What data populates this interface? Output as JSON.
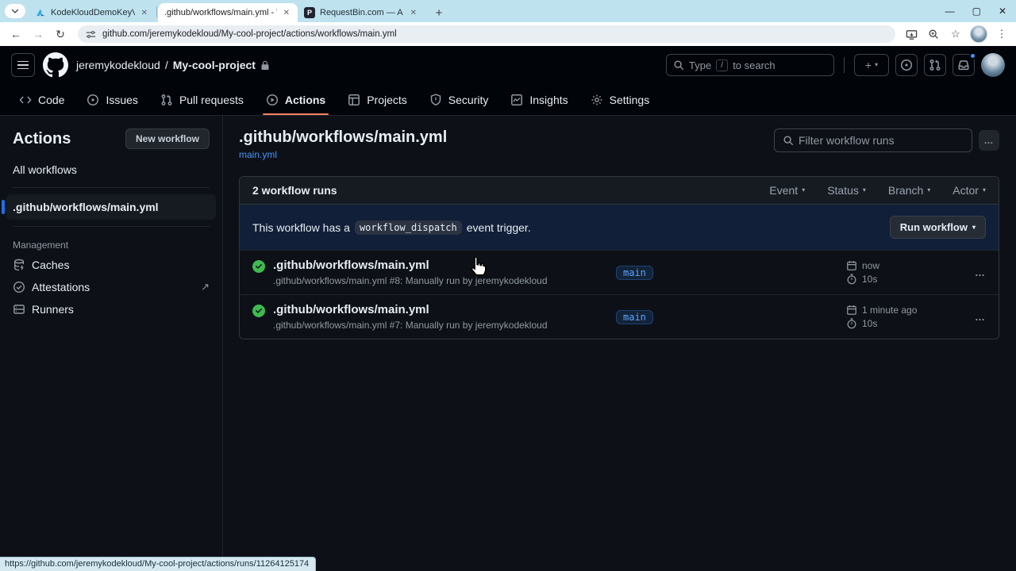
{
  "browser": {
    "tabs": [
      {
        "title": "KodeKloudDemoKeyVault - Mic"
      },
      {
        "title": ".github/workflows/main.yml - W"
      },
      {
        "title": "RequestBin.com — A modern r",
        "favicon_letter": "P"
      }
    ],
    "close_glyph": "✕",
    "new_tab_glyph": "+",
    "window_controls": {
      "minimize": "—",
      "maximize": "▢",
      "close": "✕"
    },
    "back_glyph": "←",
    "forward_glyph": "→",
    "refresh_glyph": "↻",
    "url": "github.com/jeremykodekloud/My-cool-project/actions/workflows/main.yml",
    "star_glyph": "☆",
    "menu_glyph": "⋮"
  },
  "header": {
    "owner": "jeremykodekloud",
    "separator": "/",
    "repo": "My-cool-project",
    "search": {
      "pre": "Type",
      "key": "/",
      "post": "to search"
    },
    "plus_glyph": "+"
  },
  "nav": {
    "items": [
      {
        "label": "Code"
      },
      {
        "label": "Issues"
      },
      {
        "label": "Pull requests"
      },
      {
        "label": "Actions"
      },
      {
        "label": "Projects"
      },
      {
        "label": "Security"
      },
      {
        "label": "Insights"
      },
      {
        "label": "Settings"
      }
    ]
  },
  "sidebar": {
    "title": "Actions",
    "new_workflow_label": "New workflow",
    "all_workflows_label": "All workflows",
    "selected_workflow": ".github/workflows/main.yml",
    "management_label": "Management",
    "items": [
      {
        "label": "Caches"
      },
      {
        "label": "Attestations",
        "external": "↗"
      },
      {
        "label": "Runners"
      }
    ]
  },
  "main": {
    "title": ".github/workflows/main.yml",
    "file_link": "main.yml",
    "filter_placeholder": "Filter workflow runs",
    "kebab_glyph": "…",
    "runs_count": "2 workflow runs",
    "filters": [
      {
        "label": "Event"
      },
      {
        "label": "Status"
      },
      {
        "label": "Branch"
      },
      {
        "label": "Actor"
      }
    ],
    "banner": {
      "text_pre": "This workflow has a",
      "code": "workflow_dispatch",
      "text_post": "event trigger.",
      "run_button": "Run workflow"
    },
    "runs": [
      {
        "title": ".github/workflows/main.yml",
        "desc": ".github/workflows/main.yml #8: Manually run by jeremykodekloud",
        "branch": "main",
        "time": "now",
        "duration": "10s"
      },
      {
        "title": ".github/workflows/main.yml",
        "desc": ".github/workflows/main.yml #7: Manually run by jeremykodekloud",
        "branch": "main",
        "time": "1 minute ago",
        "duration": "10s"
      }
    ]
  },
  "statusbar": {
    "url": "https://github.com/jeremykodekloud/My-cool-project/actions/runs/11264125174"
  },
  "colors": {
    "accent_blue": "#4493f8",
    "success_green": "#3fb950",
    "active_tab_underline": "#f78166",
    "branch_badge_text": "#58a6ff"
  }
}
